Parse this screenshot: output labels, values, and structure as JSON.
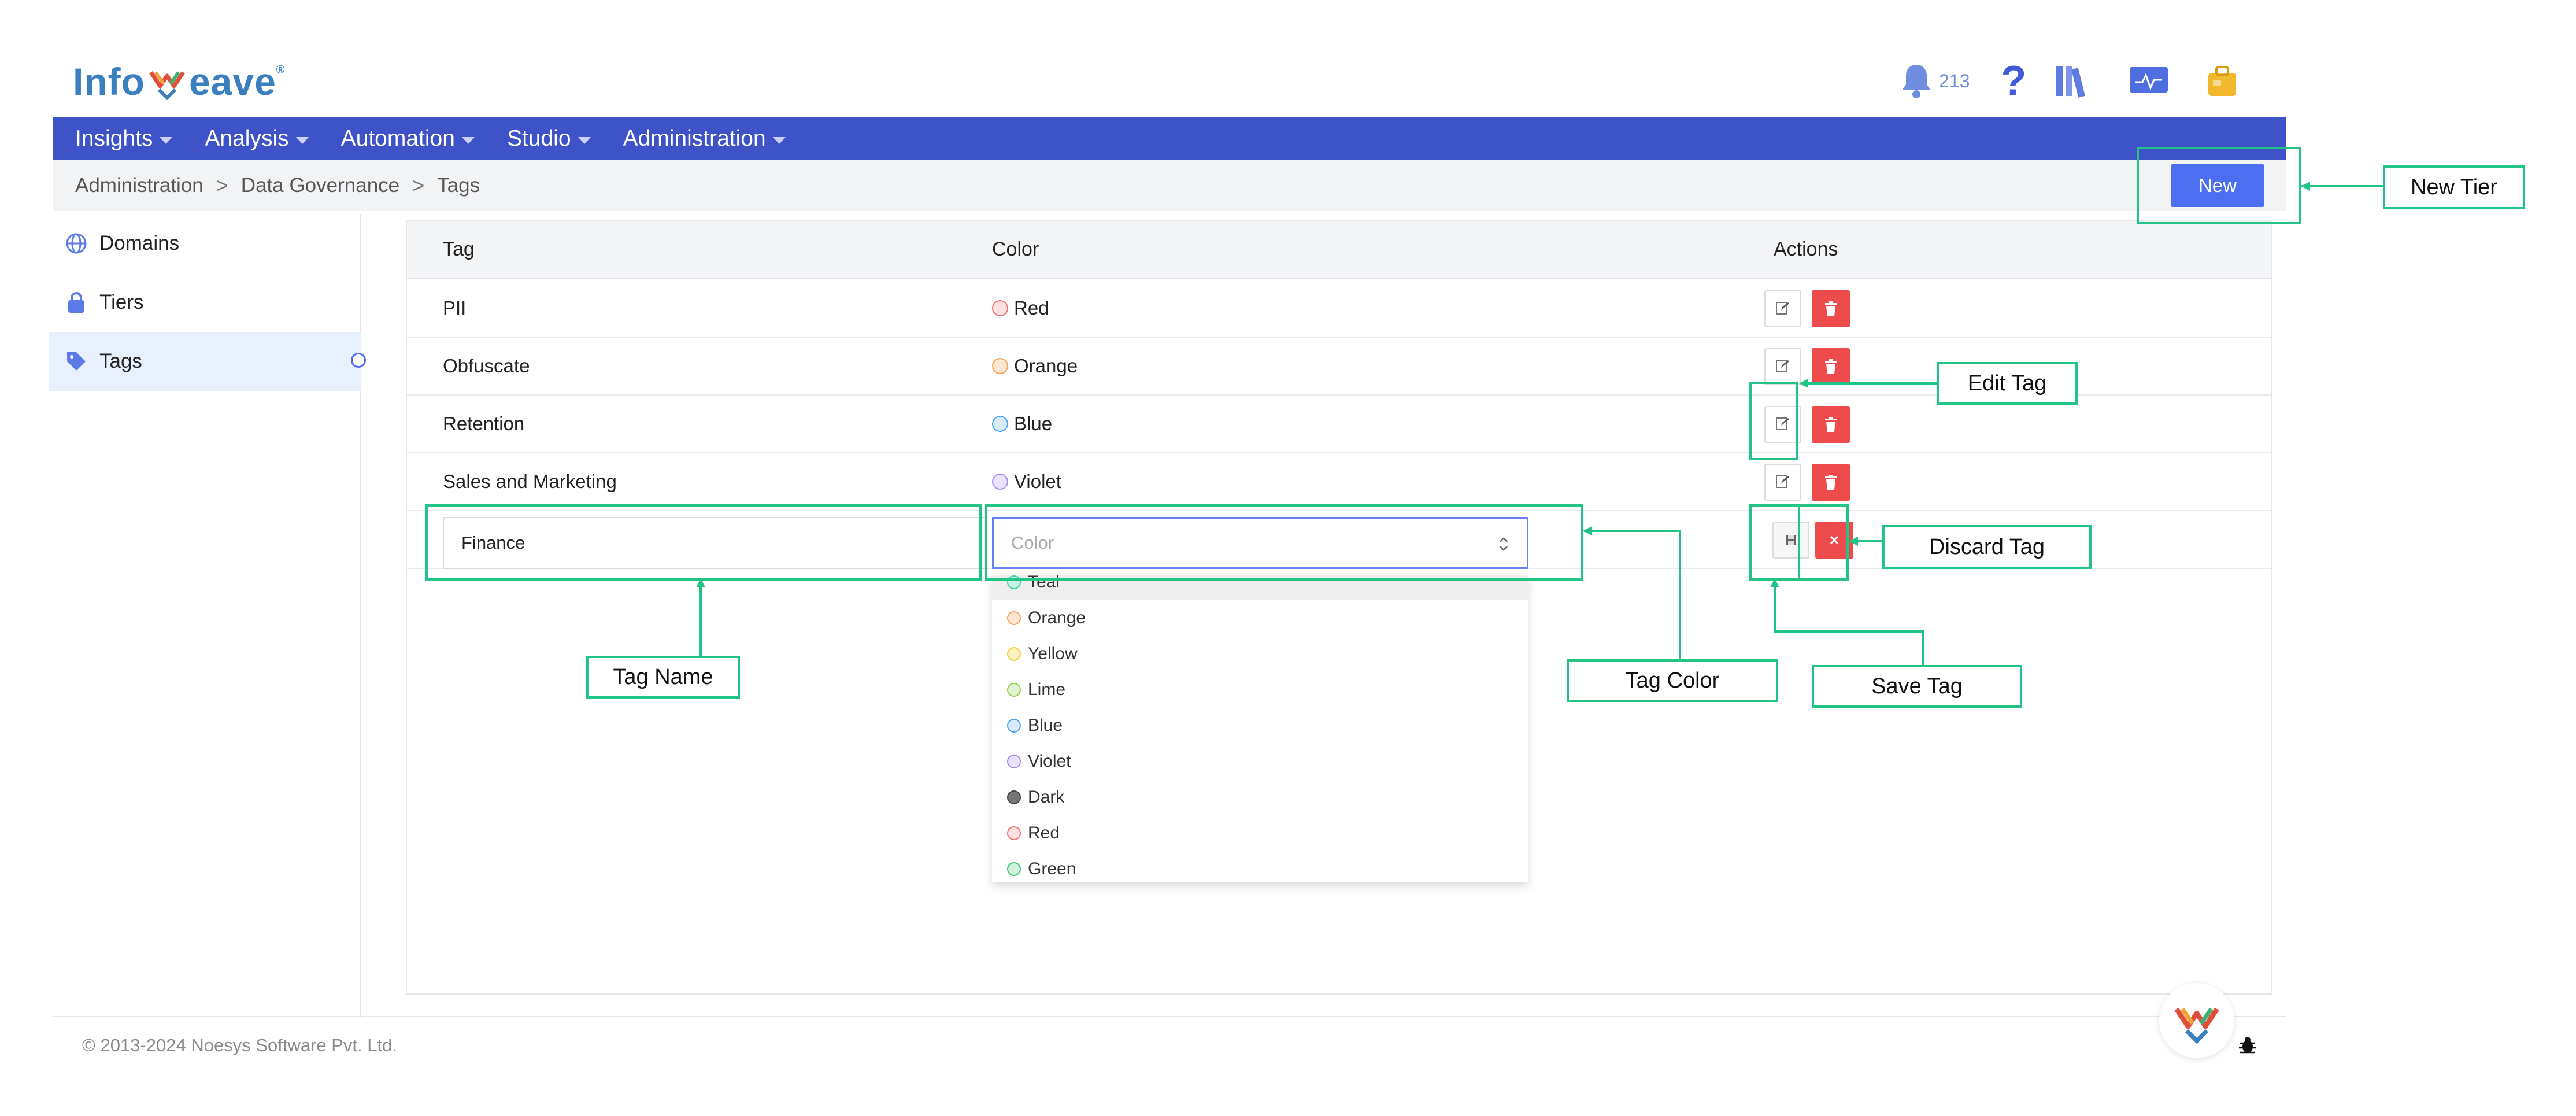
{
  "brand": {
    "logo_prefix": "Info",
    "logo_suffix": "eave",
    "registered": "®"
  },
  "header": {
    "notification_count": "213",
    "help_glyph": "?"
  },
  "nav": {
    "items": [
      {
        "label": "Insights"
      },
      {
        "label": "Analysis"
      },
      {
        "label": "Automation"
      },
      {
        "label": "Studio"
      },
      {
        "label": "Administration"
      }
    ]
  },
  "breadcrumb": {
    "items": [
      "Administration",
      "Data Governance",
      "Tags"
    ],
    "separator": ">"
  },
  "toolbar": {
    "new_label": "New"
  },
  "sidebar": {
    "items": [
      {
        "label": "Domains",
        "icon": "globe-icon"
      },
      {
        "label": "Tiers",
        "icon": "lock-icon"
      },
      {
        "label": "Tags",
        "icon": "tag-icon",
        "active": true
      }
    ]
  },
  "table": {
    "headers": {
      "tag": "Tag",
      "color": "Color",
      "actions": "Actions"
    },
    "rows": [
      {
        "tag": "PII",
        "color": "Red"
      },
      {
        "tag": "Obfuscate",
        "color": "Orange"
      },
      {
        "tag": "Retention",
        "color": "Blue"
      },
      {
        "tag": "Sales and Marketing",
        "color": "Violet"
      }
    ],
    "new_row": {
      "tag_value": "Finance",
      "color_placeholder": "Color"
    }
  },
  "dropdown": {
    "options": [
      "Teal",
      "Orange",
      "Yellow",
      "Lime",
      "Blue",
      "Violet",
      "Dark",
      "Red",
      "Green"
    ],
    "highlighted": "Teal"
  },
  "colors": {
    "Teal": "#3fd0a8",
    "Orange": "#f6a25a",
    "Yellow": "#f4cf3a",
    "Lime": "#8fd14f",
    "Blue": "#4aa3f0",
    "Violet": "#a58af0",
    "Dark": "#444444",
    "Red": "#f07373",
    "Green": "#3fc36a",
    "accent": "#4c6ef0",
    "nav": "#3f53c9",
    "danger": "#ee4c4c",
    "annotation": "#22c486"
  },
  "footer": {
    "copyright": "© 2013-2024 Noesys Software Pvt. Ltd."
  },
  "annotations": {
    "new_tier": "New Tier",
    "edit_tag": "Edit Tag",
    "discard_tag": "Discard Tag",
    "tag_name": "Tag Name",
    "tag_color": "Tag Color",
    "save_tag": "Save Tag"
  }
}
